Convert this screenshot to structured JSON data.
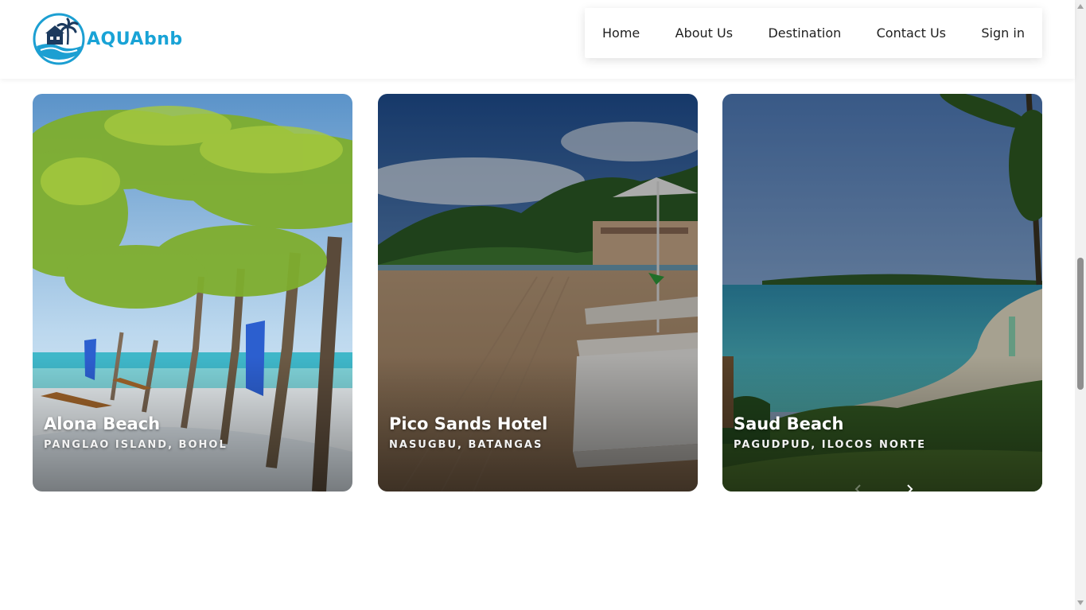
{
  "brand": {
    "name": "AQUAbnb",
    "accent": "#19a3d6",
    "dark": "#1c3a5e"
  },
  "nav": {
    "items": [
      {
        "label": "Home"
      },
      {
        "label": "About Us"
      },
      {
        "label": "Destination"
      },
      {
        "label": "Contact Us"
      },
      {
        "label": "Sign in"
      }
    ]
  },
  "destinations": [
    {
      "title": "Alona Beach",
      "location": "PANGLAO ISLAND, BOHOL",
      "image": "palm-beach-photo"
    },
    {
      "title": "Pico Sands Hotel",
      "location": "NASUGBU, BATANGAS",
      "image": "sand-beach-loungers-photo"
    },
    {
      "title": "Saud Beach",
      "location": "PAGUDPUD, ILOCOS NORTE",
      "image": "bay-coast-photo"
    }
  ],
  "carousel": {
    "prev_icon": "chevron-left-icon",
    "next_icon": "chevron-right-icon"
  }
}
